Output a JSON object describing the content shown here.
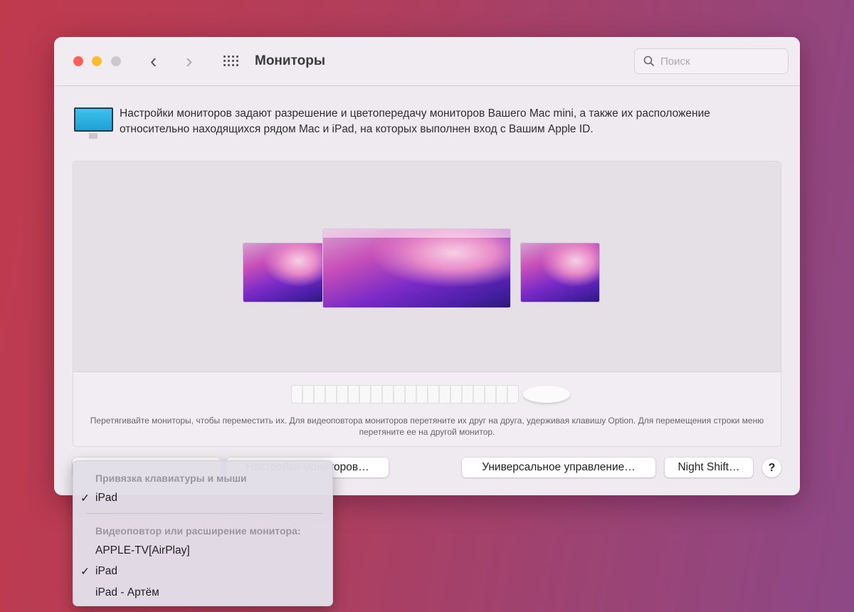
{
  "window": {
    "title": "Мониторы",
    "search_placeholder": "Поиск"
  },
  "description": "Настройки мониторов задают разрешение и цветопередачу мониторов Вашего Mac mini, а также их расположение относительно находящихся рядом Mac и iPad, на которых выполнен вход с Вашим Apple ID.",
  "arrangement": {
    "hint": "Перетягивайте мониторы, чтобы переместить их. Для видеоповтора мониторов перетяните их друг на друга, удерживая клавишу Option. Для перемещения строки меню перетяните ее на другой монитор."
  },
  "buttons": {
    "display_settings": "Настройки мониторов…",
    "universal_control": "Универсальное управление…",
    "night_shift": "Night Shift…",
    "help": "?"
  },
  "menu": {
    "section1_header": "Привязка клавиатуры и мыши",
    "section1_items": [
      {
        "label": "iPad",
        "checked": true
      }
    ],
    "section2_header": "Видеоповтор или расширение монитора:",
    "section2_items": [
      {
        "label": "APPLE-TV[AirPlay]",
        "checked": false
      },
      {
        "label": "iPad",
        "checked": true
      },
      {
        "label": "iPad - Артём",
        "checked": false
      }
    ],
    "check": "✓"
  }
}
